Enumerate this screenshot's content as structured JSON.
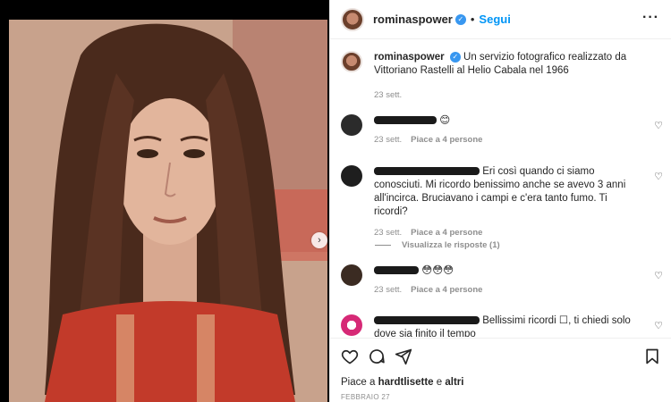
{
  "post": {
    "username": "rominaspower",
    "follow_label": "Segui",
    "separator": "•",
    "more_label": "···",
    "next_label": "›"
  },
  "caption": {
    "username": "rominaspower",
    "text": "Un servizio fotografico realizzato da Vittoriano Rastelli al Helio Cabala nel 1966",
    "time": "23 sett."
  },
  "comments": [
    {
      "text": "",
      "emoji": "😊",
      "time": "23 sett.",
      "likes": "Piace a 4 persone"
    },
    {
      "text": "Eri così quando ci siamo conosciuti. Mi ricordo benissimo anche se avevo 3 anni all'incirca. Bruciavano i campi e c'era tanto fumo. Ti ricordi?",
      "time": "23 sett.",
      "likes": "Piace a 4 persone"
    },
    {
      "text": "",
      "emoji": "😳😳😳",
      "time": "23 sett.",
      "likes": "Piace a 4 persone"
    },
    {
      "text": "Bellissimi ricordi ☐, ti chiedi solo dove sia finito il tempo",
      "time": "",
      "likes": ""
    }
  ],
  "view_replies": "Visualizza le risposte (1)",
  "footer": {
    "likes_prefix": "Piace a",
    "likes_user": "hardtlisette",
    "likes_join": "e",
    "likes_others": "altri",
    "date": "FEBBRAIO 27"
  },
  "icons": [
    "heart-icon",
    "comment-icon",
    "share-icon",
    "bookmark-icon",
    "verified-icon",
    "more-icon",
    "chevron-right-icon"
  ],
  "colors": {
    "accent": "#0095f6",
    "verified": "#3897f0",
    "muted": "#8e8e8e"
  }
}
